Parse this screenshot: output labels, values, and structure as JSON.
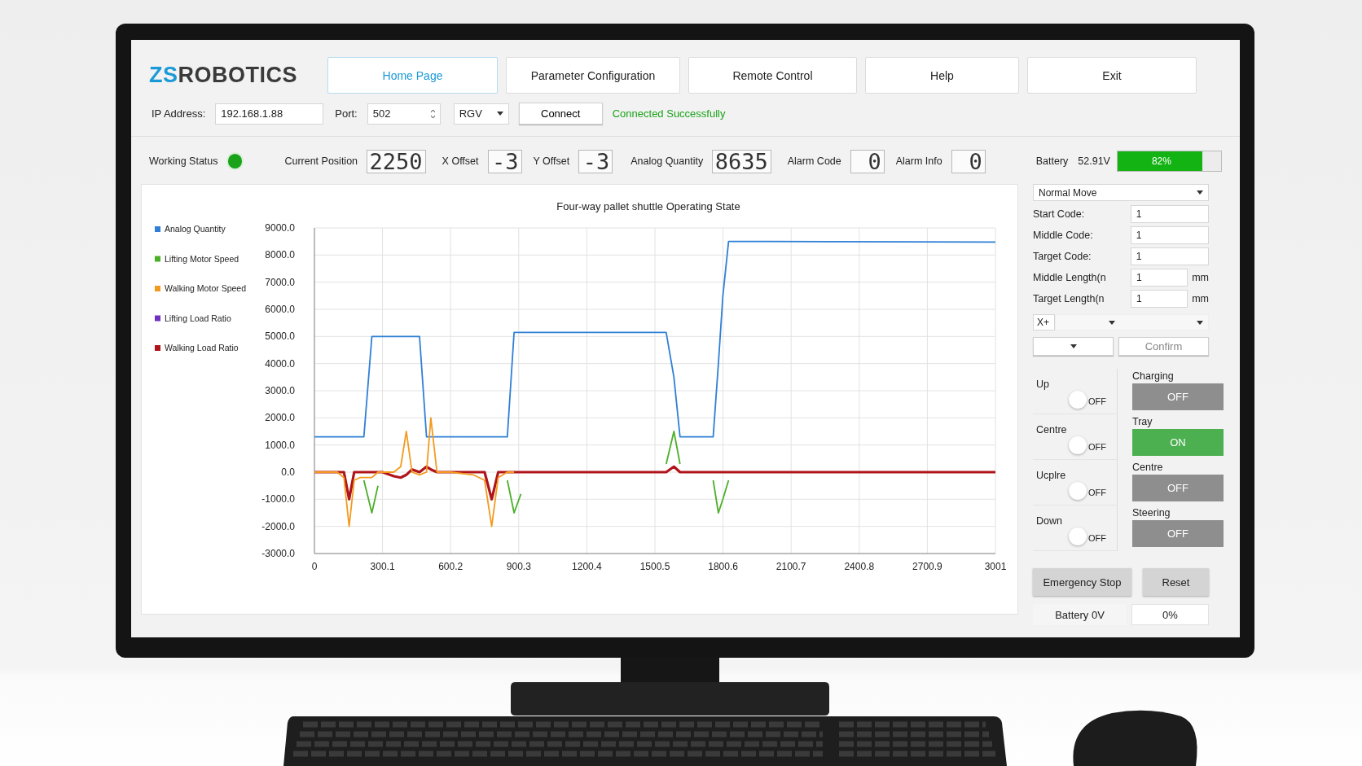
{
  "logo": {
    "prefix": "ZS",
    "name": "ROBOTICS"
  },
  "nav": [
    {
      "label": "Home Page",
      "selected": true
    },
    {
      "label": "Parameter Configuration",
      "selected": false
    },
    {
      "label": "Remote Control",
      "selected": false
    },
    {
      "label": "Help",
      "selected": false
    },
    {
      "label": "Exit",
      "selected": false
    }
  ],
  "connection": {
    "ip_label": "IP Address:",
    "ip": "192.168.1.88",
    "port_label": "Port:",
    "port": "502",
    "mode": "RGV",
    "connect_button": "Connect",
    "status": "Connected Successfully"
  },
  "status_row": {
    "working_label": "Working Status",
    "running": true,
    "readouts": [
      {
        "label": "Current Position",
        "value": "2250"
      },
      {
        "label": "X Offset",
        "value": "-3"
      },
      {
        "label": "Y Offset",
        "value": "-3"
      },
      {
        "label": "Analog Quantity",
        "value": "8635"
      },
      {
        "label": "Alarm Code",
        "value": "0"
      },
      {
        "label": "Alarm Info",
        "value": "0"
      }
    ],
    "battery": {
      "label": "Battery",
      "voltage": "52.91V",
      "level": 0.82,
      "reading": "82%"
    }
  },
  "chart": {
    "chart_data": {
      "type": "line",
      "title": "Four-way pallet shuttle Operating State",
      "x": [
        0,
        100,
        130,
        153,
        175,
        200,
        218,
        253,
        280,
        300,
        350,
        380,
        405,
        430,
        463,
        494,
        513,
        540,
        600,
        700,
        750,
        781,
        810,
        850,
        880,
        910,
        1000,
        1500,
        1550,
        1584,
        1611,
        1700,
        1757,
        1780,
        1800,
        1825,
        2000,
        3001
      ],
      "series": [
        {
          "name": "Analog Quantity",
          "color": "#2f7fd6",
          "values": [
            1300,
            1300,
            1300,
            1300,
            1300,
            1300,
            1300,
            5000,
            5000,
            5000,
            5000,
            5000,
            5000,
            5000,
            5000,
            1300,
            1300,
            1300,
            1300,
            1300,
            1300,
            1300,
            1300,
            1300,
            5150,
            5150,
            5150,
            5150,
            5150,
            3500,
            1300,
            1300,
            1300,
            4000,
            6500,
            8500,
            8500,
            8480
          ]
        },
        {
          "name": "Lifting Motor Speed",
          "color": "#4caf2a",
          "values": [
            null,
            null,
            null,
            null,
            null,
            null,
            -300,
            -1500,
            -500,
            null,
            null,
            null,
            null,
            null,
            null,
            null,
            null,
            null,
            null,
            null,
            null,
            null,
            null,
            -300,
            -1500,
            -800,
            null,
            null,
            300,
            1500,
            300,
            null,
            -300,
            -1500,
            -1000,
            -300,
            null,
            null
          ]
        },
        {
          "name": "Walking Motor Speed",
          "color": "#f39a1e",
          "values": [
            0,
            0,
            -200,
            -2000,
            -300,
            -200,
            -200,
            -200,
            0,
            0,
            0,
            200,
            1500,
            0,
            -100,
            0,
            2000,
            0,
            0,
            -100,
            -300,
            -2000,
            -200,
            0,
            0,
            null,
            null,
            null,
            null,
            null,
            null,
            null,
            null,
            null,
            null,
            null,
            null,
            null
          ]
        },
        {
          "name": "Lifting Load Ratio",
          "color": "#7030c0",
          "values": [
            null,
            null,
            null,
            null,
            null,
            null,
            null,
            null,
            null,
            null,
            null,
            null,
            null,
            null,
            null,
            null,
            null,
            null,
            null,
            null,
            null,
            null,
            null,
            null,
            null,
            null,
            null,
            null,
            null,
            null,
            null,
            null,
            null,
            null,
            null,
            null,
            null,
            null
          ]
        },
        {
          "name": "Walking Load Ratio",
          "color": "#b0141b",
          "values": [
            0,
            0,
            0,
            -1000,
            0,
            0,
            0,
            0,
            0,
            0,
            -150,
            -200,
            -100,
            100,
            0,
            200,
            100,
            0,
            0,
            0,
            0,
            -1000,
            0,
            0,
            0,
            0,
            0,
            0,
            0,
            200,
            0,
            0,
            0,
            0,
            0,
            0,
            0,
            0
          ]
        }
      ],
      "grid": true,
      "legend": "left",
      "xlim": [
        0,
        3001
      ],
      "ylim": [
        -3000,
        9000
      ],
      "xticks": [
        {
          "value": 0,
          "label": "0"
        },
        {
          "value": 300.1,
          "label": "300.1"
        },
        {
          "value": 600.2,
          "label": "600.2"
        },
        {
          "value": 900.3,
          "label": "900.3"
        },
        {
          "value": 1200.4,
          "label": "1200.4"
        },
        {
          "value": 1500.5,
          "label": "1500.5"
        },
        {
          "value": 1800.6,
          "label": "1800.6"
        },
        {
          "value": 2100.7,
          "label": "2100.7"
        },
        {
          "value": 2400.8,
          "label": "2400.8"
        },
        {
          "value": 2700.9,
          "label": "2700.9"
        },
        {
          "value": 3001,
          "label": "3001"
        }
      ],
      "yticks": [
        {
          "value": 9000,
          "label": "9000.0"
        },
        {
          "value": 8000,
          "label": "8000.0"
        },
        {
          "value": 7000,
          "label": "7000.0"
        },
        {
          "value": 6000,
          "label": "6000.0"
        },
        {
          "value": 5000,
          "label": "5000.0"
        },
        {
          "value": 4000,
          "label": "4000.0"
        },
        {
          "value": 3000,
          "label": "3000.0"
        },
        {
          "value": 2000,
          "label": "2000.0"
        },
        {
          "value": 1000,
          "label": "1000.0"
        },
        {
          "value": 0,
          "label": "0.0"
        },
        {
          "value": -1000,
          "label": "-1000.0"
        },
        {
          "value": -2000,
          "label": "-2000.0"
        },
        {
          "value": -3000,
          "label": "-3000.0"
        }
      ]
    }
  },
  "controls": {
    "move_mode": "Normal Move",
    "fields": [
      {
        "label": "Start Code:",
        "value": "1"
      },
      {
        "label": "Middle Code:",
        "value": "1"
      },
      {
        "label": "Target Code:",
        "value": "1"
      },
      {
        "label": "Middle Length(n",
        "value": "1",
        "unit": "mm"
      },
      {
        "label": "Target Length(n",
        "value": "1",
        "unit": "mm"
      }
    ],
    "direction": "X+",
    "confirm_button": "Confirm"
  },
  "switches": [
    {
      "label": "Up",
      "on": false,
      "state_text": "OFF"
    },
    {
      "label": "Centre",
      "on": false,
      "state_text": "OFF"
    },
    {
      "label": "Ucplre",
      "on": false,
      "state_text": "OFF"
    },
    {
      "label": "Down",
      "on": false,
      "state_text": "OFF"
    }
  ],
  "toggles": [
    {
      "label": "Charging",
      "on": false,
      "state_text": "OFF"
    },
    {
      "label": "Tray",
      "on": true,
      "state_text": "ON"
    },
    {
      "label": "Centre",
      "on": false,
      "state_text": "OFF"
    },
    {
      "label": "Steering",
      "on": false,
      "state_text": "OFF"
    }
  ],
  "emergency_button": "Emergency Stop",
  "reset_button": "Reset",
  "battery_footer": {
    "label": "Battery 0V",
    "reading": "0%"
  }
}
